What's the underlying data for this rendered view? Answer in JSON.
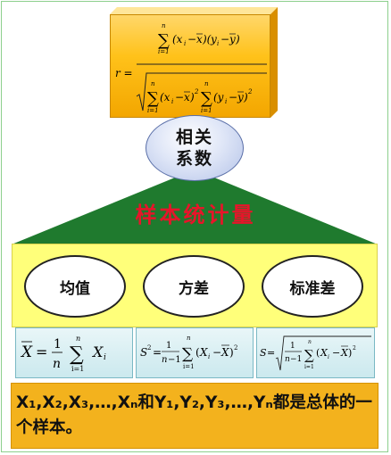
{
  "pearson_formula": {
    "lhs": "r =",
    "numerator": "∑(xᵢ − x̄)(yᵢ − ȳ)",
    "denominator": "√∑(xᵢ − x̄)² ∑(yᵢ − ȳ)²",
    "sum_upper": "n",
    "sum_lower": "i=1"
  },
  "correlation_label": "相关系数",
  "sample_statistics_title": "样本统计量",
  "statistics": [
    {
      "name": "均值",
      "formula": "X̄ = (1/n) ∑ Xᵢ"
    },
    {
      "name": "方差",
      "formula": "S² = (1/(n−1)) ∑ (Xᵢ − X̄)²"
    },
    {
      "name": "标准差",
      "formula": "S = √[(1/(n−1)) ∑ (Xᵢ − X̄)²]"
    }
  ],
  "sample_statement": "X₁,X₂,X₃,…,Xₙ和Y₁,Y₂,Y₃,…,Yₙ都是总体的一个样本。",
  "colors": {
    "triangle": "#1f7a2e",
    "title_red": "#e8142a",
    "band_yellow": "#ffff7a",
    "box_orange": "#ffc21a",
    "bar_orange": "#f3b21d"
  }
}
